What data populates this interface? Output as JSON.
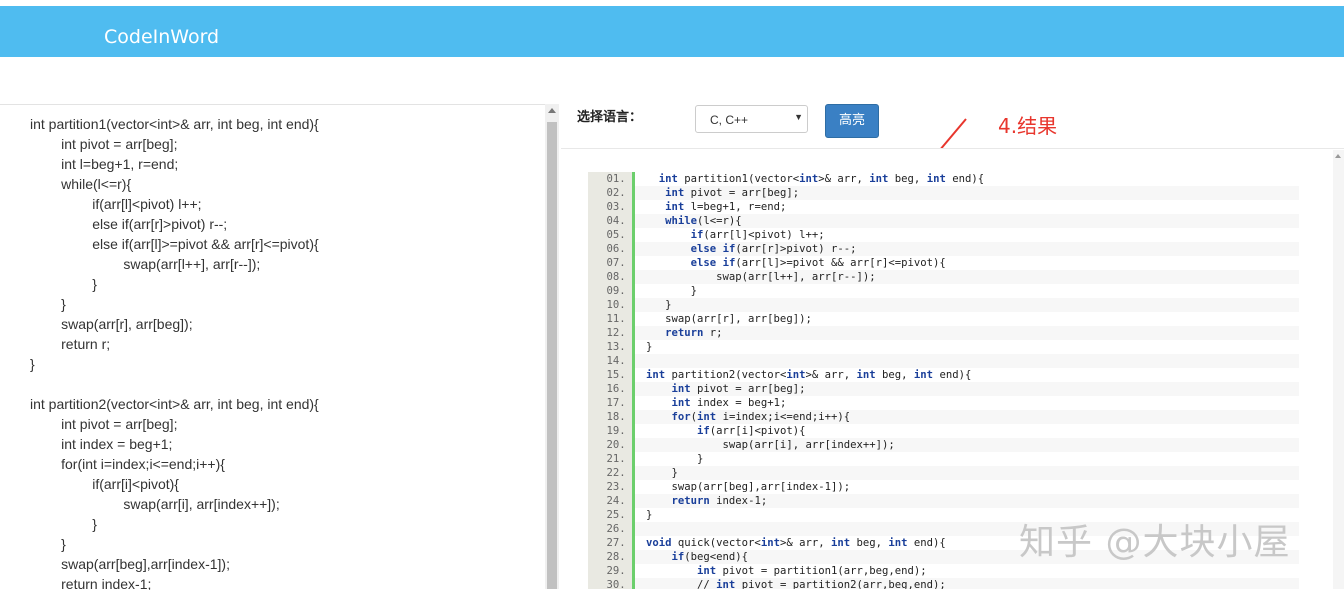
{
  "header": {
    "brand": "CodeInWord"
  },
  "left_editor": {
    "lines": [
      "int partition1(vector<int>& arr, int beg, int end){",
      "        int pivot = arr[beg];",
      "        int l=beg+1, r=end;",
      "        while(l<=r){",
      "                if(arr[l]<pivot) l++;",
      "                else if(arr[r]>pivot) r--;",
      "                else if(arr[l]>=pivot && arr[r]<=pivot){",
      "                        swap(arr[l++], arr[r--]);",
      "                }",
      "        }",
      "        swap(arr[r], arr[beg]);",
      "        return r;",
      "}",
      "",
      "int partition2(vector<int>& arr, int beg, int end){",
      "        int pivot = arr[beg];",
      "        int index = beg+1;",
      "        for(int i=index;i<=end;i++){",
      "                if(arr[i]<pivot){",
      "                        swap(arr[i], arr[index++]);",
      "                }",
      "        }",
      "        swap(arr[beg],arr[index-1]);",
      "        return index-1;"
    ]
  },
  "toolbar": {
    "lang_label": "选择语言：",
    "lang_value": "C, C++",
    "highlight_button": "高亮"
  },
  "annotation": "4.结果",
  "result": {
    "lines": [
      {
        "n": "01.",
        "t": "  int partition1(vector<int>& arr, int beg, int end){"
      },
      {
        "n": "02.",
        "t": "   int pivot = arr[beg];"
      },
      {
        "n": "03.",
        "t": "   int l=beg+1, r=end;"
      },
      {
        "n": "04.",
        "t": "   while(l<=r){"
      },
      {
        "n": "05.",
        "t": "       if(arr[l]<pivot) l++;"
      },
      {
        "n": "06.",
        "t": "       else if(arr[r]>pivot) r--;"
      },
      {
        "n": "07.",
        "t": "       else if(arr[l]>=pivot && arr[r]<=pivot){"
      },
      {
        "n": "08.",
        "t": "           swap(arr[l++], arr[r--]);"
      },
      {
        "n": "09.",
        "t": "       }"
      },
      {
        "n": "10.",
        "t": "   }"
      },
      {
        "n": "11.",
        "t": "   swap(arr[r], arr[beg]);"
      },
      {
        "n": "12.",
        "t": "   return r;"
      },
      {
        "n": "13.",
        "t": "}"
      },
      {
        "n": "14.",
        "t": ""
      },
      {
        "n": "15.",
        "t": "int partition2(vector<int>& arr, int beg, int end){"
      },
      {
        "n": "16.",
        "t": "    int pivot = arr[beg];"
      },
      {
        "n": "17.",
        "t": "    int index = beg+1;"
      },
      {
        "n": "18.",
        "t": "    for(int i=index;i<=end;i++){"
      },
      {
        "n": "19.",
        "t": "        if(arr[i]<pivot){"
      },
      {
        "n": "20.",
        "t": "            swap(arr[i], arr[index++]);"
      },
      {
        "n": "21.",
        "t": "        }"
      },
      {
        "n": "22.",
        "t": "    }"
      },
      {
        "n": "23.",
        "t": "    swap(arr[beg],arr[index-1]);"
      },
      {
        "n": "24.",
        "t": "    return index-1;"
      },
      {
        "n": "25.",
        "t": "}"
      },
      {
        "n": "26.",
        "t": ""
      },
      {
        "n": "27.",
        "t": "void quick(vector<int>& arr, int beg, int end){"
      },
      {
        "n": "28.",
        "t": "    if(beg<end){"
      },
      {
        "n": "29.",
        "t": "        int pivot = partition1(arr,beg,end);"
      },
      {
        "n": "30.",
        "t": "        // int pivot = partition2(arr,beg,end);"
      }
    ]
  },
  "watermark": "知乎 @大块小屋",
  "colors": {
    "header": "#4fbcf0",
    "button": "#3a80c4",
    "annotation": "#e8362d",
    "gutter_bar": "#6ccf6c"
  }
}
